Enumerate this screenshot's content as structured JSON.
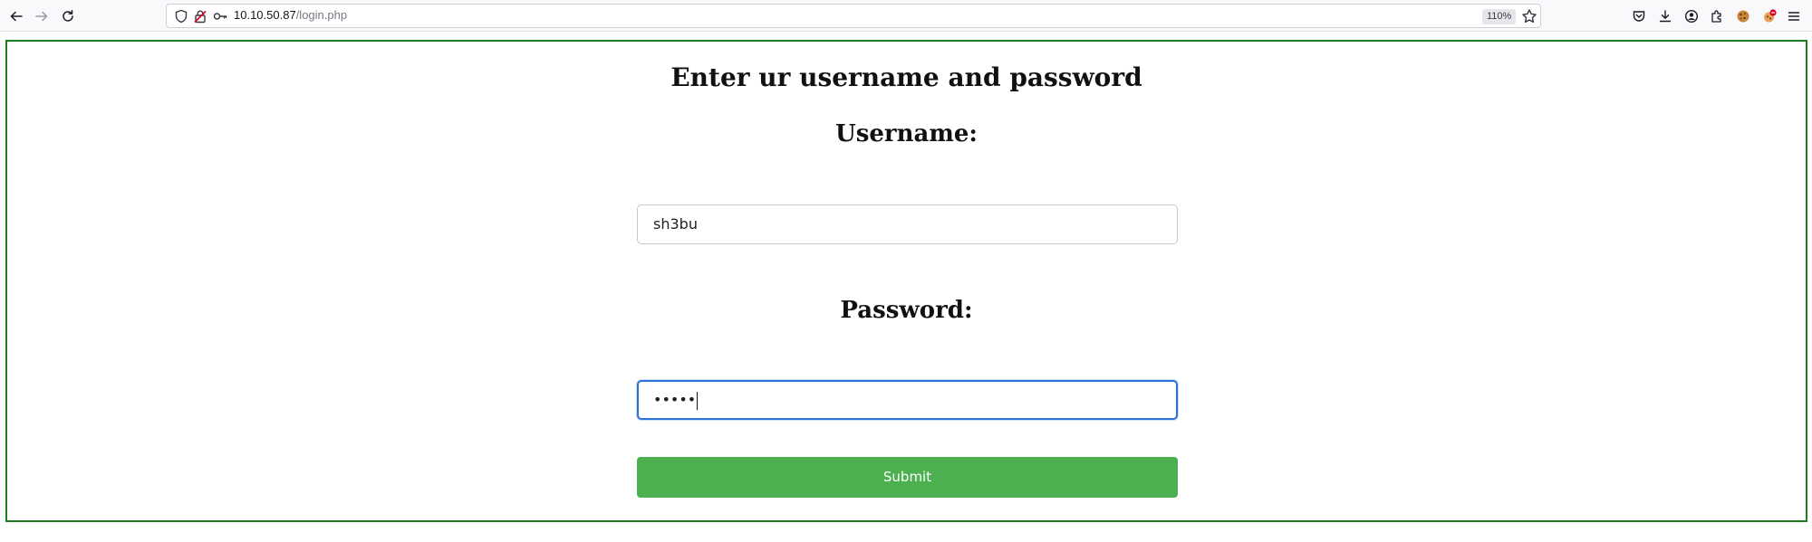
{
  "browser": {
    "url_host": "10.10.50.87",
    "url_path": "/login.php",
    "zoom": "110%",
    "nav_icons": [
      "back-arrow-icon",
      "forward-arrow-icon",
      "reload-icon"
    ],
    "url_icons": [
      "shield-icon",
      "insecure-lock-icon",
      "key-icon"
    ],
    "toolbar_icons": [
      "pocket-icon",
      "download-icon",
      "account-icon",
      "extensions-icon",
      "cookie-icon",
      "extension-badge-icon",
      "menu-icon"
    ]
  },
  "page": {
    "heading": "Enter ur username and password",
    "username_label": "Username:",
    "username_value": "sh3bu",
    "password_label": "Password:",
    "password_value": "•••••",
    "submit_label": "Submit",
    "frame_color": "#1e7d1e",
    "submit_color": "#4caf50",
    "focus_color": "#2f72d6"
  }
}
